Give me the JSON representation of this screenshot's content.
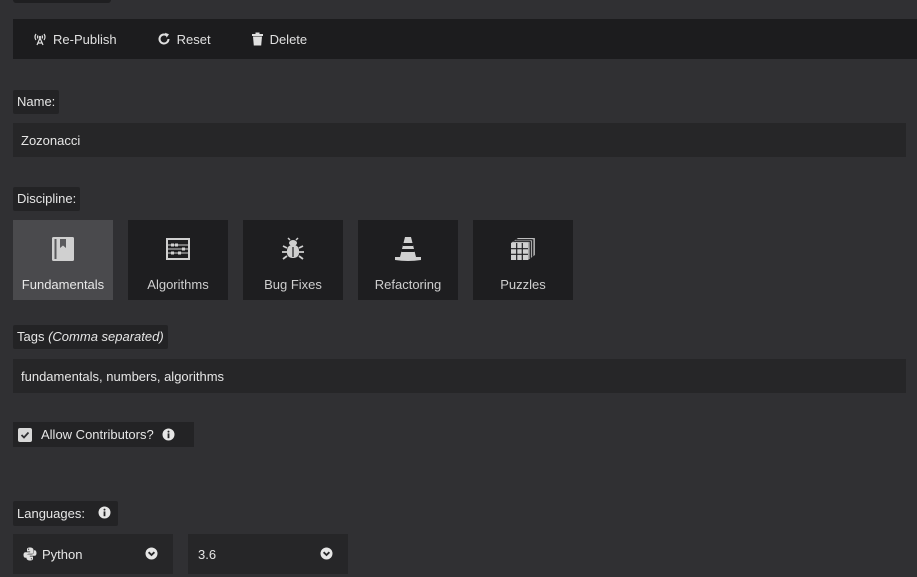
{
  "toolbar": {
    "republish_label": "Re-Publish",
    "reset_label": "Reset",
    "delete_label": "Delete"
  },
  "name": {
    "label": "Name:",
    "value": "Zozonacci"
  },
  "discipline": {
    "label": "Discipline:",
    "selected": "Fundamentals",
    "options": [
      {
        "label": "Fundamentals",
        "icon": "book-icon"
      },
      {
        "label": "Algorithms",
        "icon": "abacus-icon"
      },
      {
        "label": "Bug Fixes",
        "icon": "bug-icon"
      },
      {
        "label": "Refactoring",
        "icon": "traffic-cone-icon"
      },
      {
        "label": "Puzzles",
        "icon": "rubiks-cube-icon"
      }
    ]
  },
  "tags": {
    "label": "Tags",
    "hint": "(Comma separated)",
    "value": "fundamentals, numbers, algorithms"
  },
  "contributors": {
    "label": "Allow Contributors?",
    "checked": true
  },
  "languages": {
    "label": "Languages:",
    "language": "Python",
    "version": "3.6"
  },
  "colors": {
    "background": "#303033",
    "toolbar": "#1c1c1e",
    "tile": "#1e1e20",
    "tile_active": "#4a4a4d",
    "field": "#262628"
  }
}
